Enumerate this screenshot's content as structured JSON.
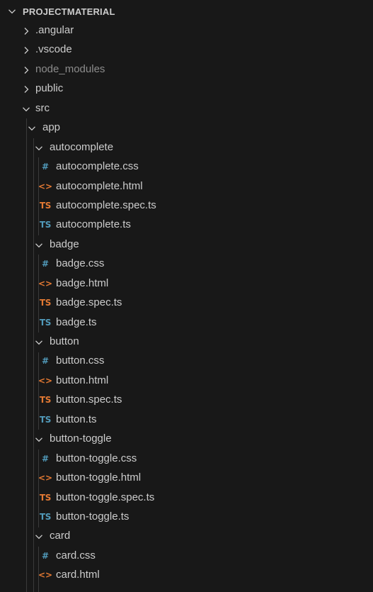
{
  "explorer": {
    "section_title": "PROJECTMATERIAL",
    "colors": {
      "background": "#181818",
      "text": "#cccccc",
      "ignored_text": "#8c8c8c",
      "css_icon": "#519aba",
      "html_icon": "#e37933",
      "spec_icon": "#e37933",
      "ts_icon": "#519aba"
    },
    "rows": [
      {
        "label": ".angular",
        "kind": "folder-collapsed",
        "depth": 0
      },
      {
        "label": ".vscode",
        "kind": "folder-collapsed",
        "depth": 0
      },
      {
        "label": "node_modules",
        "kind": "folder-collapsed",
        "depth": 0,
        "ignored": true
      },
      {
        "label": "public",
        "kind": "folder-collapsed",
        "depth": 0
      },
      {
        "label": "src",
        "kind": "folder-expanded",
        "depth": 0
      },
      {
        "label": "app",
        "kind": "folder-expanded",
        "depth": 1
      },
      {
        "label": "autocomplete",
        "kind": "folder-expanded",
        "depth": 2
      },
      {
        "label": "autocomplete.css",
        "kind": "css",
        "depth": 3,
        "icon_text": "#"
      },
      {
        "label": "autocomplete.html",
        "kind": "html",
        "depth": 3,
        "icon_text": "<>"
      },
      {
        "label": "autocomplete.spec.ts",
        "kind": "spec",
        "depth": 3,
        "icon_text": "TS"
      },
      {
        "label": "autocomplete.ts",
        "kind": "ts",
        "depth": 3,
        "icon_text": "TS"
      },
      {
        "label": "badge",
        "kind": "folder-expanded",
        "depth": 2
      },
      {
        "label": "badge.css",
        "kind": "css",
        "depth": 3,
        "icon_text": "#"
      },
      {
        "label": "badge.html",
        "kind": "html",
        "depth": 3,
        "icon_text": "<>"
      },
      {
        "label": "badge.spec.ts",
        "kind": "spec",
        "depth": 3,
        "icon_text": "TS"
      },
      {
        "label": "badge.ts",
        "kind": "ts",
        "depth": 3,
        "icon_text": "TS"
      },
      {
        "label": "button",
        "kind": "folder-expanded",
        "depth": 2
      },
      {
        "label": "button.css",
        "kind": "css",
        "depth": 3,
        "icon_text": "#"
      },
      {
        "label": "button.html",
        "kind": "html",
        "depth": 3,
        "icon_text": "<>"
      },
      {
        "label": "button.spec.ts",
        "kind": "spec",
        "depth": 3,
        "icon_text": "TS"
      },
      {
        "label": "button.ts",
        "kind": "ts",
        "depth": 3,
        "icon_text": "TS"
      },
      {
        "label": "button-toggle",
        "kind": "folder-expanded",
        "depth": 2
      },
      {
        "label": "button-toggle.css",
        "kind": "css",
        "depth": 3,
        "icon_text": "#"
      },
      {
        "label": "button-toggle.html",
        "kind": "html",
        "depth": 3,
        "icon_text": "<>"
      },
      {
        "label": "button-toggle.spec.ts",
        "kind": "spec",
        "depth": 3,
        "icon_text": "TS"
      },
      {
        "label": "button-toggle.ts",
        "kind": "ts",
        "depth": 3,
        "icon_text": "TS"
      },
      {
        "label": "card",
        "kind": "folder-expanded",
        "depth": 2
      },
      {
        "label": "card.css",
        "kind": "css",
        "depth": 3,
        "icon_text": "#"
      },
      {
        "label": "card.html",
        "kind": "html",
        "depth": 3,
        "icon_text": "<>"
      }
    ]
  }
}
